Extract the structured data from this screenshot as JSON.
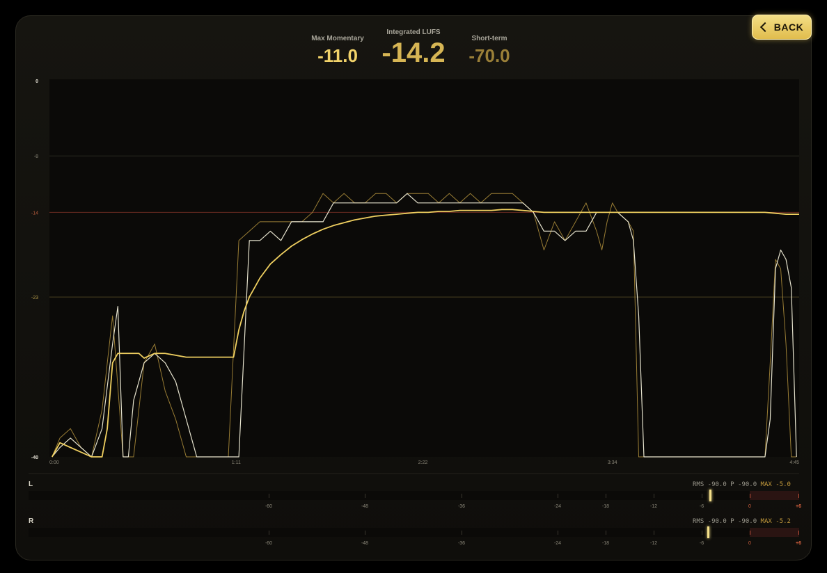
{
  "header": {
    "back_label": "BACK",
    "max_momentary": {
      "label": "Max Momentary",
      "value": "-11.0"
    },
    "integrated": {
      "label": "Integrated LUFS",
      "value": "-14.2"
    },
    "short_term": {
      "label": "Short-term",
      "value": "-70.0"
    }
  },
  "colors": {
    "accent": "#e8c65a",
    "target_line": "#6b2a22",
    "grid": "#2a2820"
  },
  "chart_data": {
    "type": "line",
    "y_axis": {
      "ylim": [
        -40,
        0
      ],
      "ticks": [
        0,
        -8,
        -14,
        -23,
        -40
      ],
      "tick_labels": [
        "0",
        "-8",
        "-14",
        "-23",
        "-40"
      ],
      "highlight": {
        "-14": "#b35a3c",
        "-23": "#b39a4a"
      }
    },
    "x_axis": {
      "xlim": [
        0,
        285
      ],
      "unit": "seconds",
      "ticks": [
        0,
        71,
        142,
        214,
        285
      ],
      "tick_labels": [
        "0:00",
        "1:11",
        "2:22",
        "3:34",
        "4:45"
      ]
    },
    "grid": true,
    "series": [
      {
        "style": "momentary",
        "x": [
          1,
          4,
          8,
          12,
          16,
          20,
          24,
          28,
          32,
          36,
          40,
          44,
          48,
          52,
          56,
          60,
          64,
          68,
          72,
          76,
          80,
          84,
          88,
          92,
          96,
          100,
          104,
          108,
          112,
          116,
          120,
          124,
          128,
          132,
          136,
          140,
          144,
          148,
          152,
          156,
          160,
          164,
          168,
          172,
          176,
          180,
          184,
          188,
          192,
          196,
          200,
          204,
          208,
          210,
          212,
          214,
          216,
          220,
          222,
          224,
          226,
          228,
          232,
          236,
          240,
          244,
          248,
          252,
          256,
          260,
          264,
          268,
          272,
          274,
          276,
          278,
          280,
          282,
          284
        ],
        "y": [
          -40,
          -38,
          -37,
          -39,
          -40,
          -35,
          -25,
          -40,
          -40,
          -30,
          -28,
          -33,
          -36,
          -40,
          -40,
          -40,
          -40,
          -40,
          -17,
          -16,
          -15,
          -15,
          -15,
          -15,
          -15,
          -14,
          -12,
          -13,
          -12,
          -13,
          -13,
          -12,
          -12,
          -13,
          -12,
          -12,
          -12,
          -13,
          -12,
          -13,
          -12,
          -13,
          -12,
          -12,
          -12,
          -13,
          -14,
          -18,
          -15,
          -17,
          -15,
          -13,
          -16,
          -18,
          -15,
          -13,
          -14,
          -15,
          -16,
          -40,
          -40,
          -40,
          -40,
          -40,
          -40,
          -40,
          -40,
          -40,
          -40,
          -40,
          -40,
          -40,
          -40,
          -30,
          -19,
          -20,
          -28,
          -40,
          -40
        ]
      },
      {
        "style": "short_term",
        "x": [
          1,
          4,
          8,
          12,
          16,
          20,
          24,
          26,
          28,
          30,
          32,
          36,
          40,
          44,
          48,
          52,
          56,
          58,
          60,
          64,
          68,
          72,
          76,
          80,
          84,
          88,
          92,
          96,
          100,
          104,
          108,
          112,
          116,
          120,
          124,
          128,
          132,
          136,
          140,
          144,
          148,
          152,
          156,
          160,
          164,
          168,
          172,
          176,
          180,
          184,
          188,
          192,
          196,
          200,
          204,
          208,
          212,
          216,
          220,
          222,
          224,
          226,
          228,
          232,
          236,
          240,
          244,
          248,
          252,
          256,
          260,
          264,
          268,
          272,
          274,
          276,
          278,
          280,
          282,
          284
        ],
        "y": [
          -40,
          -39,
          -38,
          -39,
          -40,
          -37,
          -28,
          -24,
          -40,
          -40,
          -34,
          -30,
          -29,
          -30,
          -32,
          -36,
          -40,
          -40,
          -40,
          -40,
          -40,
          -40,
          -17,
          -17,
          -16,
          -17,
          -15,
          -15,
          -15,
          -15,
          -13,
          -13,
          -13,
          -13,
          -13,
          -13,
          -13,
          -12,
          -13,
          -13,
          -13,
          -13,
          -13,
          -13,
          -13,
          -13,
          -13,
          -13,
          -13,
          -14,
          -16,
          -16,
          -17,
          -16,
          -16,
          -14,
          -14,
          -14,
          -15,
          -17,
          -25,
          -40,
          -40,
          -40,
          -40,
          -40,
          -40,
          -40,
          -40,
          -40,
          -40,
          -40,
          -40,
          -40,
          -36,
          -20,
          -18,
          -19,
          -22,
          -40
        ]
      },
      {
        "style": "integrated",
        "x": [
          1,
          4,
          8,
          12,
          16,
          20,
          22,
          24,
          26,
          30,
          34,
          36,
          40,
          44,
          48,
          52,
          56,
          60,
          64,
          68,
          70,
          72,
          74,
          76,
          78,
          80,
          84,
          88,
          92,
          96,
          100,
          104,
          108,
          112,
          116,
          120,
          124,
          128,
          132,
          136,
          140,
          144,
          148,
          152,
          156,
          160,
          164,
          168,
          172,
          176,
          180,
          184,
          188,
          192,
          196,
          200,
          204,
          208,
          212,
          216,
          220,
          224,
          228,
          232,
          236,
          240,
          244,
          248,
          252,
          256,
          260,
          264,
          268,
          272,
          276,
          280,
          285
        ],
        "y": [
          -40,
          -38.5,
          -39,
          -39.5,
          -40,
          -40,
          -37,
          -30,
          -29,
          -29,
          -29,
          -29.5,
          -29,
          -29,
          -29.2,
          -29.4,
          -29.4,
          -29.4,
          -29.4,
          -29.4,
          -29.4,
          -26.5,
          -24.5,
          -23,
          -22,
          -21,
          -19.5,
          -18.5,
          -17.6,
          -16.9,
          -16.3,
          -15.8,
          -15.4,
          -15.1,
          -14.8,
          -14.6,
          -14.4,
          -14.3,
          -14.2,
          -14.1,
          -14.0,
          -14.0,
          -13.9,
          -13.9,
          -13.8,
          -13.8,
          -13.8,
          -13.8,
          -13.7,
          -13.7,
          -13.8,
          -13.9,
          -14.0,
          -14.0,
          -14.0,
          -14.0,
          -14.0,
          -14.0,
          -14.0,
          -14.0,
          -14.0,
          -14.0,
          -14.0,
          -14.0,
          -14.0,
          -14.0,
          -14.0,
          -14.0,
          -14.0,
          -14.0,
          -14.0,
          -14.0,
          -14.0,
          -14.0,
          -14.1,
          -14.2,
          -14.2
        ]
      }
    ]
  },
  "meters": {
    "scale_labels": [
      "-60",
      "-48",
      "-36",
      "-24",
      "-18",
      "-12",
      "-6",
      "0",
      "+6"
    ],
    "scale_values": [
      -60,
      -48,
      -36,
      -24,
      -18,
      -12,
      -6,
      0,
      6
    ],
    "range": [
      -90,
      6
    ],
    "channels": [
      {
        "label": "L",
        "rms": "RMS -90.0",
        "peak": "P -90.0",
        "max": "MAX -5.0",
        "max_value": -5.0
      },
      {
        "label": "R",
        "rms": "RMS -90.0",
        "peak": "P -90.0",
        "max": "MAX -5.2",
        "max_value": -5.2
      }
    ]
  }
}
